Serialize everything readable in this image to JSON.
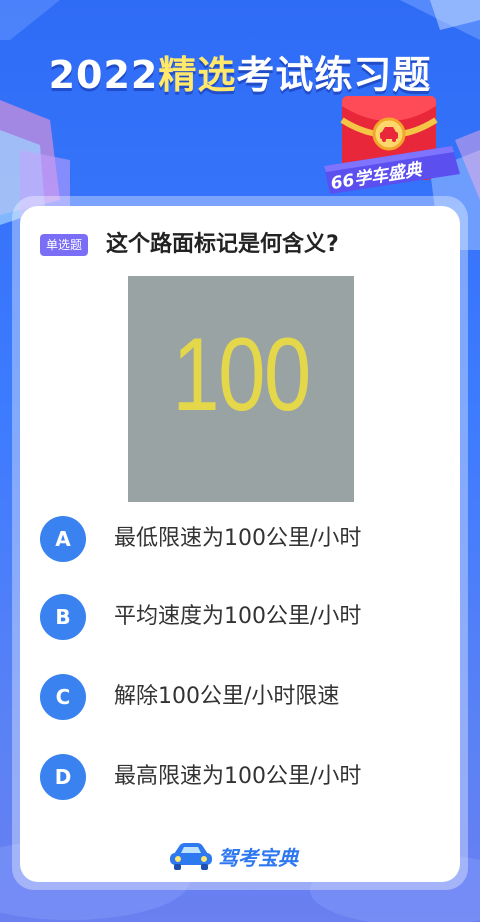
{
  "header": {
    "year": "2022",
    "highlight": "精选",
    "rest": "考试练习题"
  },
  "badge": {
    "text": "66学车盛典",
    "icon": "car-icon"
  },
  "question": {
    "tag": "单选题",
    "text": "这个路面标记是何含义?",
    "image_marking": "100"
  },
  "options": [
    {
      "letter": "A",
      "label": "最低限速为100公里/小时"
    },
    {
      "letter": "B",
      "label": "平均速度为100公里/小时"
    },
    {
      "letter": "C",
      "label": "解除100公里/小时限速"
    },
    {
      "letter": "D",
      "label": "最高限速为100公里/小时"
    }
  ],
  "footer": {
    "brand": "驾考宝典",
    "icon": "car-icon"
  },
  "colors": {
    "accent": "#3a82ef",
    "tag": "#7b6ef6",
    "highlight": "#ffe86a",
    "badge_red": "#e8283a",
    "marking_yellow": "#e4d84a"
  }
}
